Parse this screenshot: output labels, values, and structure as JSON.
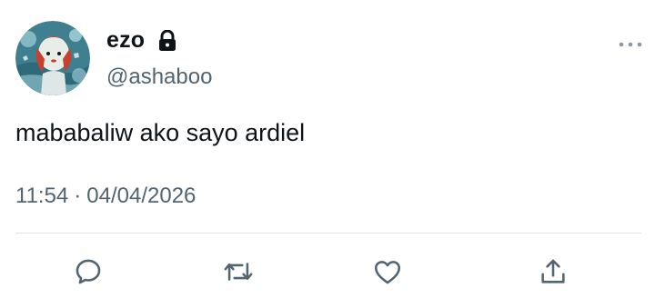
{
  "author": {
    "display_name": "ezo",
    "handle": "@ashaboo",
    "avatar_icon": "avatar-image",
    "locked_icon": "lock-icon"
  },
  "tweet": {
    "text": "mababaliw ako sayo ardiel",
    "time": "11:54",
    "separator": "·",
    "date": "04/04/2026"
  },
  "actions": {
    "reply_icon": "reply-icon",
    "retweet_icon": "retweet-icon",
    "like_icon": "heart-icon",
    "share_icon": "share-icon",
    "more_icon": "more-icon"
  },
  "colors": {
    "text": "#0f1419",
    "secondary": "#536471",
    "divider": "#dfe3e6"
  }
}
